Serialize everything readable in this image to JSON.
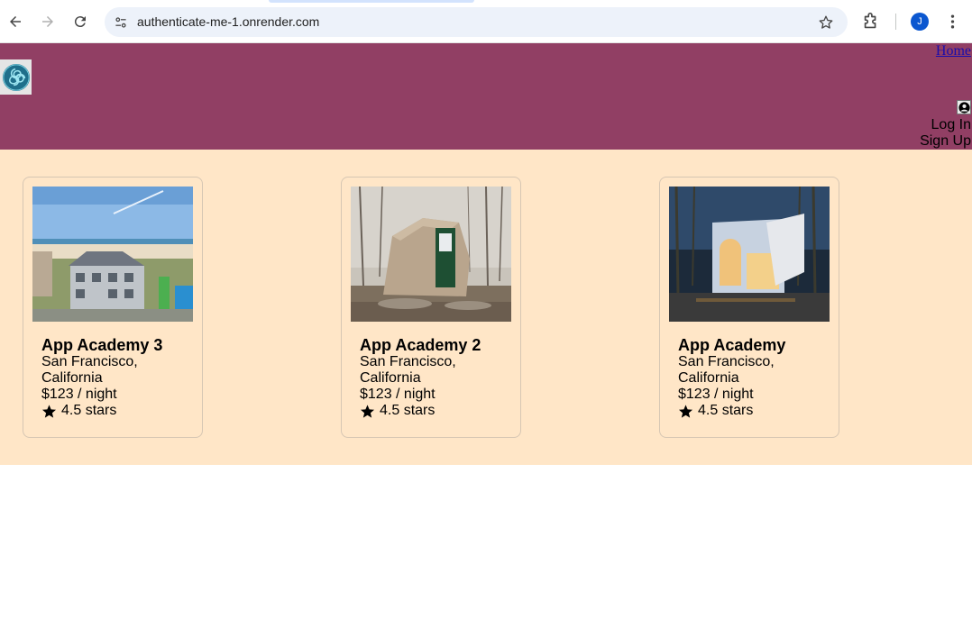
{
  "browser": {
    "url": "authenticate-me-1.onrender.com",
    "profile_initial": "J"
  },
  "header": {
    "home_label": "Home",
    "login_label": "Log In",
    "signup_label": "Sign Up",
    "brand_color": "#913f64"
  },
  "main": {
    "background": "#ffe6c7",
    "spots": [
      {
        "title": "App Academy 3",
        "location": "San Francisco, California",
        "price": "$123 / night",
        "rating": "4.5 stars",
        "image_icon": "beach-house-photo"
      },
      {
        "title": "App Academy 2",
        "location": "San Francisco, California",
        "price": "$123 / night",
        "rating": "4.5 stars",
        "image_icon": "wood-hut-photo"
      },
      {
        "title": "App Academy",
        "location": "San Francisco, California",
        "price": "$123 / night",
        "rating": "4.5 stars",
        "image_icon": "modern-house-photo"
      }
    ]
  }
}
